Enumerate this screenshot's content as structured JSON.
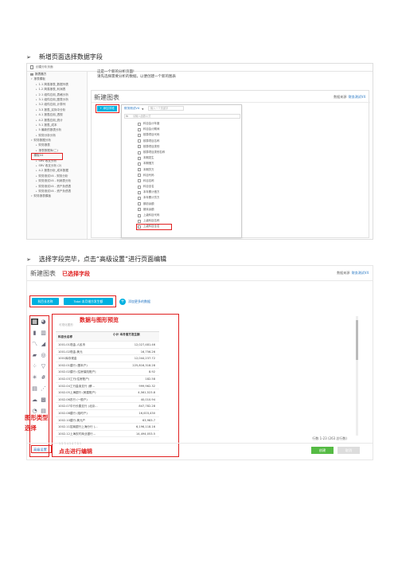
{
  "step1": {
    "bullet": "新增页面选择数据字段",
    "crumb": "创建分析页面",
    "sidebar_header": "报表魔方",
    "sidebar_sections": [
      "报表模板",
      "1.1 简易报表_数据列表",
      "1.2 简易报表_利润表",
      "2.1 组件应用_表格分析",
      "3.1 组件应用_图表分析",
      "3.2 组件应用_计算列",
      "3.3 报表_实际中分析",
      "4.1 报表应用_透视",
      "4.2 报表应用_统计",
      "5.1 报表_成本",
      "5 最新的报表分析",
      "财务分析分析"
    ],
    "sidebar_section2": "财务数据分析",
    "sidebar_section2_items": [
      "财务报表",
      "报表数据库(二)"
    ],
    "sidebar_section3": "模板V4",
    "sidebar_section3_items": [
      "SRV 收支分析",
      "SRV 收支分析 (2)",
      "4.2 报表分析_成本数据",
      "财务测试V4 - 财务分析",
      "财务测试V4 - 利润表分析",
      "财务测试V4 - 资产负债表",
      "财务测试V4 - 资产负债表"
    ],
    "sidebar_footer": "财务报表模板",
    "hint_line1": "这是一个新的分析页面!",
    "hint_line2": "请先选择需要分析的数据，以便创建一个新的图表",
    "new_chart_title": "新建图表",
    "dataset_prefix": "数据来源:",
    "dataset_name": "财务测试V4",
    "add_field_button": "+ 添加字段",
    "datasource_label": "财务测试V4",
    "search_placeholder": "输入一个关键字",
    "fx_placeholder": "请输入函数公式",
    "fields": [
      "科目会计年度",
      "科目会计期间",
      "核算项目代码",
      "核算项目名称",
      "核算项目类别",
      "核算项目类别名称",
      "本期发生",
      "本期借方",
      "本期贷方",
      "科目代码",
      "科目名称",
      "科目全名",
      "本年累计借方",
      "本年累计贷方",
      "期初余额",
      "期末余额",
      "上级科目代码",
      "上级科目名称",
      "上级科目全名"
    ]
  },
  "step2": {
    "bullet": "选择字段完毕，点击“高级设置”进行页面编辑",
    "new_chart_title": "新建图表",
    "dataset_prefix": "数据来源:",
    "dataset_name": "财务测试V4",
    "chip1": "科目长名称",
    "chip2": "Total 本月借方发生额",
    "add_field_button": "+ 添加字段",
    "add_more_label": "添加更多的数据",
    "label_selected": "已选择字段",
    "label_preview": "数据与图形预览",
    "label_chart_type_1": "图形类型",
    "label_chart_type_2": "选择",
    "label_edit": "点击进行编辑",
    "toolbar_title": "可视化图形",
    "table_header_1": "科目长名称",
    "table_header_2": "小计 本月借方发生额",
    "rows": [
      [
        "1001.01现金-人民币",
        "12,027,481.46"
      ],
      [
        "1001.02现金-美元",
        "16,756.26"
      ],
      [
        "1001库存现金",
        "12,044,237.72"
      ],
      [
        "1002.01建行 (基本户)",
        "225,816,318.28"
      ],
      [
        "1002.02建行 (住房保险账户)",
        "8.92"
      ],
      [
        "1002.03工行(住房账户)",
        "182.58"
      ],
      [
        "1002.04工行盐渎支行 (薪...",
        "999,962.32"
      ],
      [
        "1002.05上海银行 (房屋账户)",
        "4,561,523.8"
      ],
      [
        "1002.06农行 (一般户)",
        "40,010.94"
      ],
      [
        "1002.07中行长春支行 (北京...",
        "847,782.28"
      ],
      [
        "1002.08建行 (临时户)",
        "16,003,430"
      ],
      [
        "1002.10建行-美元户",
        "63,983.7"
      ],
      [
        "1002.11招商银行上海分行 (...",
        "6,196,118.16"
      ],
      [
        "1002.12上海农村商业银行...",
        "14,494,053.5"
      ]
    ],
    "pager": "1 2 3 4 5 6 7 8 9",
    "page_info": "行数 1-23 (263 总行数)",
    "advanced_button": "高级设置",
    "create_button": "创建",
    "cancel_button": "取消"
  },
  "colors": {
    "red": "#e02020",
    "blue": "#00b0e0",
    "green": "#55bb44",
    "link": "#1a6fc0"
  }
}
